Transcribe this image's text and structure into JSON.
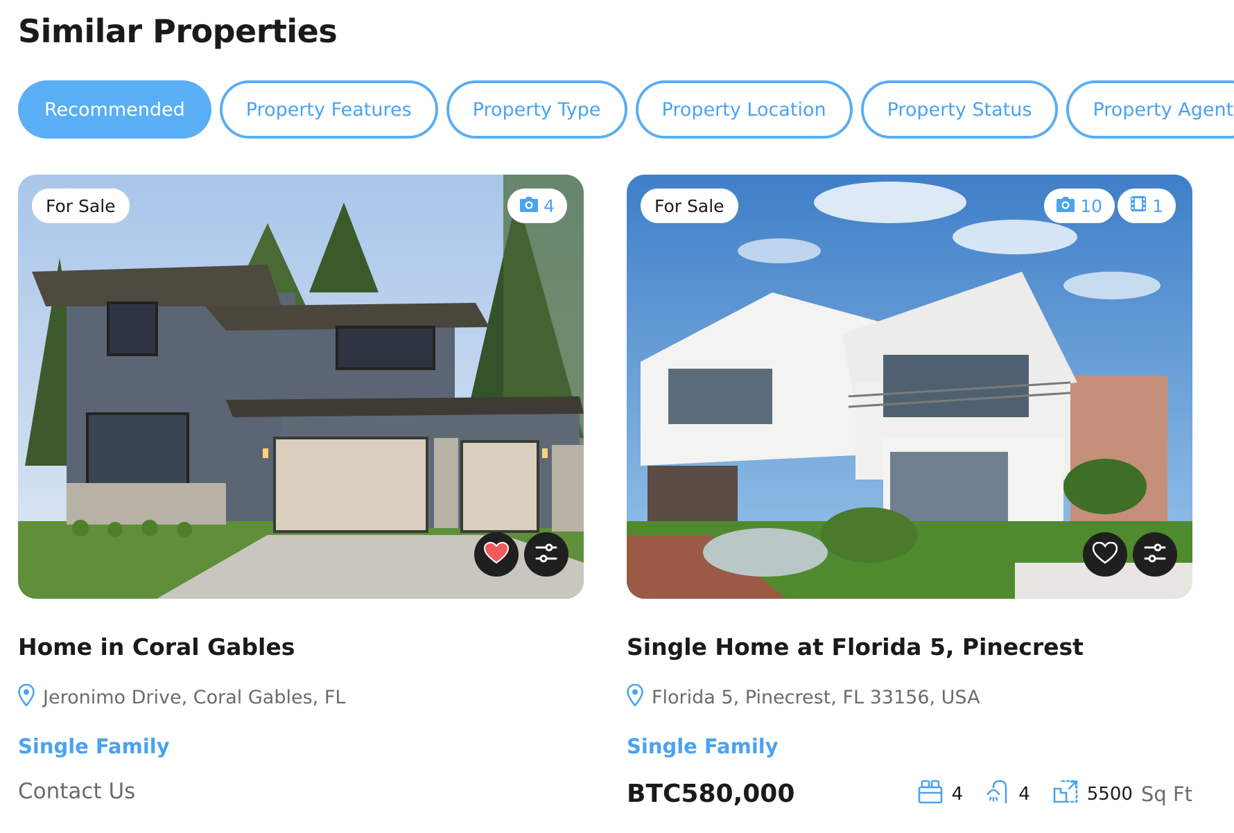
{
  "section": {
    "title": "Similar Properties"
  },
  "tabs": [
    {
      "label": "Recommended",
      "active": true
    },
    {
      "label": "Property Features",
      "active": false
    },
    {
      "label": "Property Type",
      "active": false
    },
    {
      "label": "Property Location",
      "active": false
    },
    {
      "label": "Property Status",
      "active": false
    },
    {
      "label": "Property Agent",
      "active": false
    }
  ],
  "listings": [
    {
      "status": "For Sale",
      "photo_count": "4",
      "favorited": true,
      "title": "Home in Coral Gables",
      "address": "Jeronimo Drive, Coral Gables, FL",
      "type": "Single Family",
      "contact": "Contact Us"
    },
    {
      "status": "For Sale",
      "photo_count": "10",
      "video_count": "1",
      "favorited": false,
      "title": "Single Home at Florida 5, Pinecrest",
      "address": "Florida 5, Pinecrest, FL 33156, USA",
      "type": "Single Family",
      "price": "BTC580,000",
      "beds": "4",
      "baths": "4",
      "area": "5500",
      "area_unit": "Sq Ft"
    }
  ],
  "colors": {
    "accent": "#5aaef3",
    "accent_text": "#4aa3ef",
    "favorite": "#ef5a5a",
    "dark_button": "#1f1f1f"
  },
  "icons": [
    "camera-icon",
    "video-icon",
    "heart-icon",
    "compare-icon",
    "location-pin-icon",
    "bed-icon",
    "shower-icon",
    "area-icon"
  ]
}
